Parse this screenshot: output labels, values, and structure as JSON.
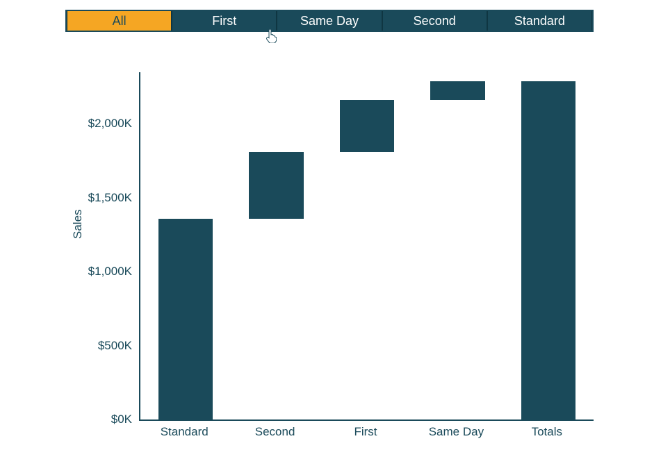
{
  "tabs": {
    "items": [
      {
        "label": "All",
        "active": true
      },
      {
        "label": "First",
        "active": false
      },
      {
        "label": "Same Day",
        "active": false
      },
      {
        "label": "Second",
        "active": false
      },
      {
        "label": "Standard",
        "active": false
      }
    ]
  },
  "cursor": {
    "semantic": "hand-pointer-icon"
  },
  "chart_data": {
    "type": "waterfall",
    "ylabel": "Sales",
    "ylim": [
      0,
      2350
    ],
    "ticks": [
      0,
      500,
      1000,
      1500,
      2000
    ],
    "tick_labels": [
      "$0K",
      "$500K",
      "$1,000K",
      "$1,500K",
      "$2,000K"
    ],
    "x_labels": [
      "Standard",
      "Second",
      "First",
      "Same Day",
      "Totals"
    ],
    "segments": [
      {
        "name": "Standard",
        "start": 0,
        "end": 1360,
        "kind": "step"
      },
      {
        "name": "Second",
        "start": 1360,
        "end": 1810,
        "kind": "step"
      },
      {
        "name": "First",
        "start": 1810,
        "end": 2160,
        "kind": "step"
      },
      {
        "name": "Same Day",
        "start": 2160,
        "end": 2290,
        "kind": "step"
      },
      {
        "name": "Totals",
        "start": 0,
        "end": 2290,
        "kind": "total"
      }
    ],
    "colors": {
      "bar": "#1a4a5a",
      "accent": "#f5a623"
    }
  }
}
